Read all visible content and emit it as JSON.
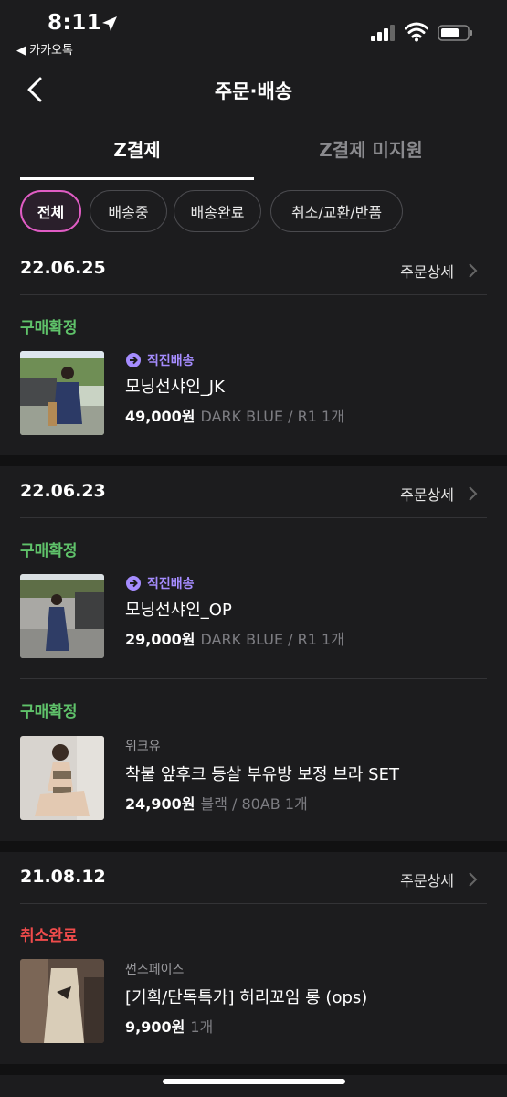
{
  "status_bar": {
    "time": "8:11",
    "back_app": "◀ 카카오톡"
  },
  "nav": {
    "title": "주문·배송"
  },
  "tabs": [
    {
      "label": "Z결제"
    },
    {
      "label": "Z결제 미지원"
    }
  ],
  "filters": [
    {
      "label": "전체"
    },
    {
      "label": "배송중"
    },
    {
      "label": "배송완료"
    },
    {
      "label": "취소/교환/반품"
    }
  ],
  "orders": [
    {
      "date": "22.06.25",
      "detail_label": "주문상세",
      "items": [
        {
          "status": "구매확정",
          "store": "직진배송",
          "name": "모닝선샤인_JK",
          "price": "49,000원",
          "option": "DARK BLUE / R1 1개"
        }
      ]
    },
    {
      "date": "22.06.23",
      "detail_label": "주문상세",
      "items": [
        {
          "status": "구매확정",
          "store": "직진배송",
          "name": "모닝선샤인_OP",
          "price": "29,000원",
          "option": "DARK BLUE / R1 1개"
        },
        {
          "status": "구매확정",
          "store": "위크유",
          "name": "착붙 앞후크 등살 부유방 보정 브라 SET",
          "price": "24,900원",
          "option": "블랙 / 80AB 1개"
        }
      ]
    },
    {
      "date": "21.08.12",
      "detail_label": "주문상세",
      "items": [
        {
          "status": "취소완료",
          "store": "썬스페이스",
          "name": "[기획/단독특가] 허리꼬임 롱 (ops)",
          "price": "9,900원",
          "option": "1개"
        }
      ]
    }
  ],
  "colors": {
    "confirmed": "#5fc26a",
    "cancelled": "#ef4b4b",
    "accent": "#e05cc4",
    "direct": "#a58cff"
  }
}
